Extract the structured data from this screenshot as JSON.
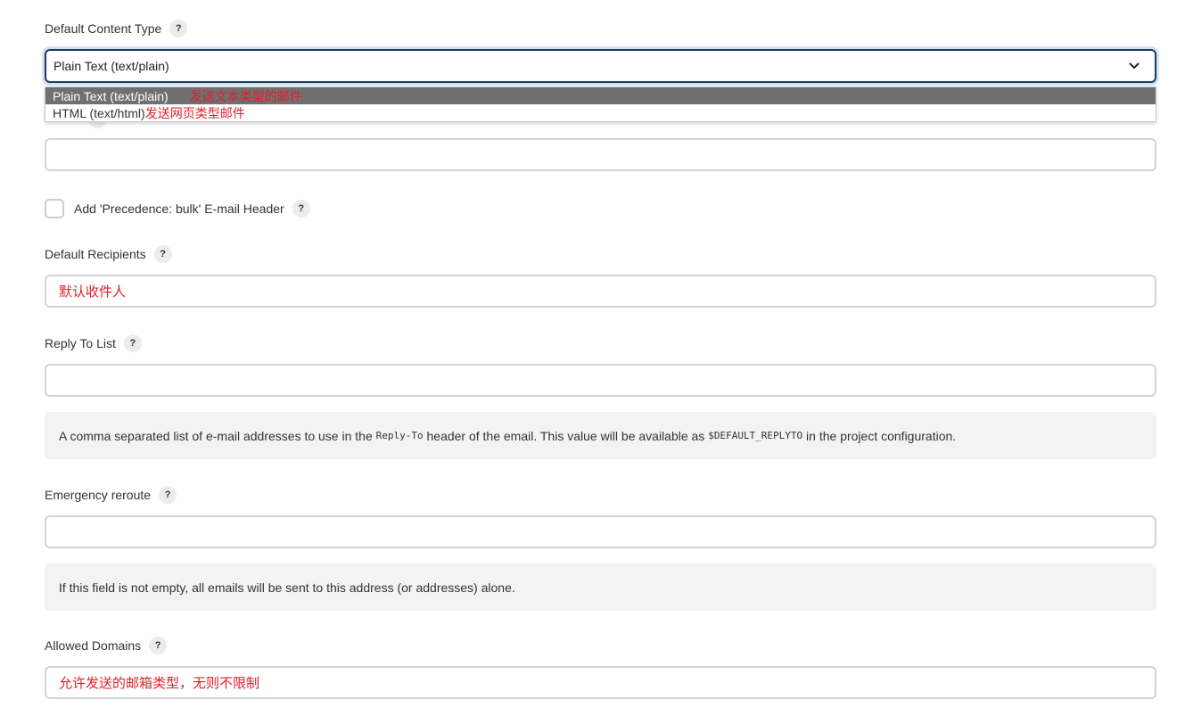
{
  "content_type": {
    "label": "Default Content Type",
    "selected": "Plain Text (text/plain)",
    "options": [
      {
        "text": "Plain Text (text/plain)",
        "note": "发送文本类型的邮件"
      },
      {
        "text": "HTML (text/html)",
        "note": "发送网页类型邮件"
      }
    ]
  },
  "precedence": {
    "label": "Add 'Precedence: bulk' E-mail Header",
    "checked": false
  },
  "recipients": {
    "label": "Default Recipients",
    "value": "默认收件人"
  },
  "reply_to": {
    "label": "Reply To List",
    "value": "",
    "help_prefix": "A comma separated list of e-mail addresses to use in the ",
    "help_code1": "Reply-To",
    "help_middle": " header of the email. This value will be available as ",
    "help_code2": "$DEFAULT_REPLYTO",
    "help_suffix": " in the project configuration."
  },
  "emergency": {
    "label": "Emergency reroute",
    "value": "",
    "help": "If this field is not empty, all emails will be sent to this address (or addresses) alone."
  },
  "allowed_domains": {
    "label": "Allowed Domains",
    "value": "允许发送的邮箱类型，无则不限制"
  },
  "help_glyph": "?",
  "colors": {
    "annotation": "#e0202a",
    "selected_option_bg": "#707070",
    "focus_border": "#1f3a56"
  }
}
